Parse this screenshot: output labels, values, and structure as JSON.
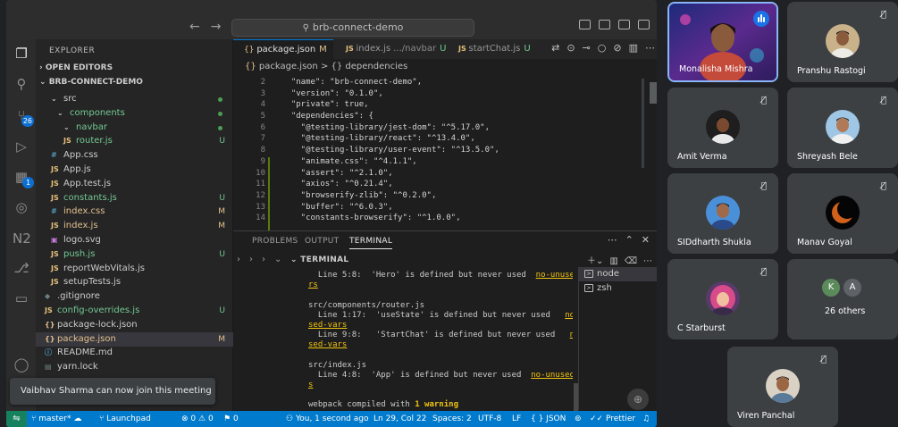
{
  "vscode": {
    "command_center": "brb-connect-demo",
    "activity": {
      "scm_badge": "26",
      "ext_badge": "1"
    },
    "explorer": {
      "title": "EXPLORER",
      "open_editors": "OPEN EDITORS",
      "project": "BRB-CONNECT-DEMO",
      "items": [
        {
          "name": "src",
          "icon": "chevron-down",
          "indent": 1,
          "status": "dot"
        },
        {
          "name": "components",
          "icon": "chevron-down",
          "indent": 2,
          "status": "dot",
          "color": "#73c991"
        },
        {
          "name": "navbar",
          "icon": "chevron-down",
          "indent": 3,
          "status": "dot",
          "color": "#73c991"
        },
        {
          "name": "router.js",
          "icon": "JS",
          "indent": 3,
          "status": "U",
          "color": "#73c991"
        },
        {
          "name": "App.css",
          "icon": "#",
          "indent": 1,
          "status": ""
        },
        {
          "name": "App.js",
          "icon": "JS",
          "indent": 1,
          "status": ""
        },
        {
          "name": "App.test.js",
          "icon": "JS",
          "indent": 1,
          "status": ""
        },
        {
          "name": "constants.js",
          "icon": "JS",
          "indent": 1,
          "status": "U",
          "color": "#73c991"
        },
        {
          "name": "index.css",
          "icon": "#",
          "indent": 1,
          "status": "M",
          "color": "#e2c08d"
        },
        {
          "name": "index.js",
          "icon": "JS",
          "indent": 1,
          "status": "M",
          "color": "#e2c08d"
        },
        {
          "name": "logo.svg",
          "icon": "img",
          "indent": 1,
          "status": ""
        },
        {
          "name": "push.js",
          "icon": "JS",
          "indent": 1,
          "status": "U",
          "color": "#73c991"
        },
        {
          "name": "reportWebVitals.js",
          "icon": "JS",
          "indent": 1,
          "status": ""
        },
        {
          "name": "setupTests.js",
          "icon": "JS",
          "indent": 1,
          "status": ""
        },
        {
          "name": ".gitignore",
          "icon": "git",
          "indent": 0,
          "status": ""
        },
        {
          "name": "config-overrides.js",
          "icon": "JS",
          "indent": 0,
          "status": "U",
          "color": "#73c991"
        },
        {
          "name": "package-lock.json",
          "icon": "{}",
          "indent": 0,
          "status": ""
        },
        {
          "name": "package.json",
          "icon": "{}",
          "indent": 0,
          "status": "M",
          "color": "#e2c08d",
          "selected": true
        },
        {
          "name": "README.md",
          "icon": "i",
          "indent": 0,
          "status": ""
        },
        {
          "name": "yarn.lock",
          "icon": "lock",
          "indent": 0,
          "status": ""
        }
      ]
    },
    "tabs": [
      {
        "icon": "{}",
        "label": "package.json",
        "desc": "",
        "status": "M"
      },
      {
        "icon": "JS",
        "label": "index.js",
        "desc": ".../navbar",
        "status": "U"
      },
      {
        "icon": "JS",
        "label": "startChat.js",
        "desc": "",
        "status": "U"
      }
    ],
    "breadcrumb": {
      "file": "package.json",
      "sep": ">",
      "symbol": "{} dependencies"
    },
    "code": [
      {
        "n": "2",
        "text": "  \"name\": \"brb-connect-demo\","
      },
      {
        "n": "3",
        "text": "  \"version\": \"0.1.0\","
      },
      {
        "n": "4",
        "text": "  \"private\": true,"
      },
      {
        "n": "5",
        "text": "  \"dependencies\": {"
      },
      {
        "n": "6",
        "text": "    \"@testing-library/jest-dom\": \"^5.17.0\","
      },
      {
        "n": "7",
        "text": "    \"@testing-library/react\": \"^13.4.0\","
      },
      {
        "n": "8",
        "text": "    \"@testing-library/user-event\": \"^13.5.0\","
      },
      {
        "n": "9",
        "text": "    \"animate.css\": \"^4.1.1\","
      },
      {
        "n": "10",
        "text": "    \"assert\": \"^2.1.0\","
      },
      {
        "n": "11",
        "text": "    \"axios\": \"^0.21.4\","
      },
      {
        "n": "12",
        "text": "    \"browserify-zlib\": \"^0.2.0\","
      },
      {
        "n": "13",
        "text": "    \"buffer\": \"^6.0.3\","
      },
      {
        "n": "14",
        "text": "    \"constants-browserify\": \"^1.0.0\","
      }
    ],
    "panel_tabs": [
      "PROBLEMS",
      "OUTPUT",
      "TERMINAL"
    ],
    "terminal_title": "TERMINAL",
    "terminal_lines": [
      {
        "pre": "  Line 5:8:  'Hero' is defined but never used  ",
        "link": "no-unused-va"
      },
      {
        "pre": "",
        "link": "rs"
      },
      {
        "pre": "",
        "link": ""
      },
      {
        "pre": "src/components/router.js",
        "link": ""
      },
      {
        "pre": "  Line 1:17:  'useState' is defined but never used   ",
        "link": "no-unu"
      },
      {
        "pre": "",
        "link": "sed-vars"
      },
      {
        "pre": "  Line 9:8:   'StartChat' is defined but never used   ",
        "link": "no-unu"
      },
      {
        "pre": "",
        "link": "sed-vars"
      },
      {
        "pre": "",
        "link": ""
      },
      {
        "pre": "src/index.js",
        "link": ""
      },
      {
        "pre": "  Line 4:8:  'App' is defined but never used  ",
        "link": "no-unused-var"
      },
      {
        "pre": "",
        "link": "s"
      },
      {
        "pre": "",
        "link": ""
      },
      {
        "pre": "webpack compiled with ",
        "bold": "1 warning"
      }
    ],
    "terminal_instances": [
      {
        "label": "node",
        "active": true
      },
      {
        "label": "zsh",
        "active": false
      }
    ],
    "status": {
      "branch": "master*",
      "launchpad": "Launchpad",
      "errors": "0",
      "warnings": "0",
      "info": "0",
      "blame": "You, 1 second ago",
      "cursor": "Ln 29, Col 22",
      "spaces": "Spaces: 2",
      "encoding": "UTF-8",
      "eol": "LF",
      "language": "{ } JSON",
      "prettier": "Prettier"
    }
  },
  "toast": "Vaibhav Sharma can now join this meeting",
  "meet": {
    "participants": [
      {
        "name": "Monalisha Mishra",
        "state": "speaking"
      },
      {
        "name": "Pranshu Rastogi",
        "state": "muted"
      },
      {
        "name": "Amit Verma",
        "state": "muted"
      },
      {
        "name": "Shreyash Bele",
        "state": "muted"
      },
      {
        "name": "SIDdharth Shukla",
        "state": "muted"
      },
      {
        "name": "Manav Goyal",
        "state": "muted"
      },
      {
        "name": "C Starburst",
        "state": "muted"
      },
      {
        "name": "26 others",
        "state": "group"
      },
      {
        "name": "Viren Panchal",
        "state": "muted"
      }
    ],
    "others_avatars": [
      "K",
      "A"
    ]
  },
  "colors": {
    "statusbar": "#007acc",
    "modified": "#e2c08d",
    "untracked": "#73c991",
    "meet_tile": "#3c4043"
  }
}
